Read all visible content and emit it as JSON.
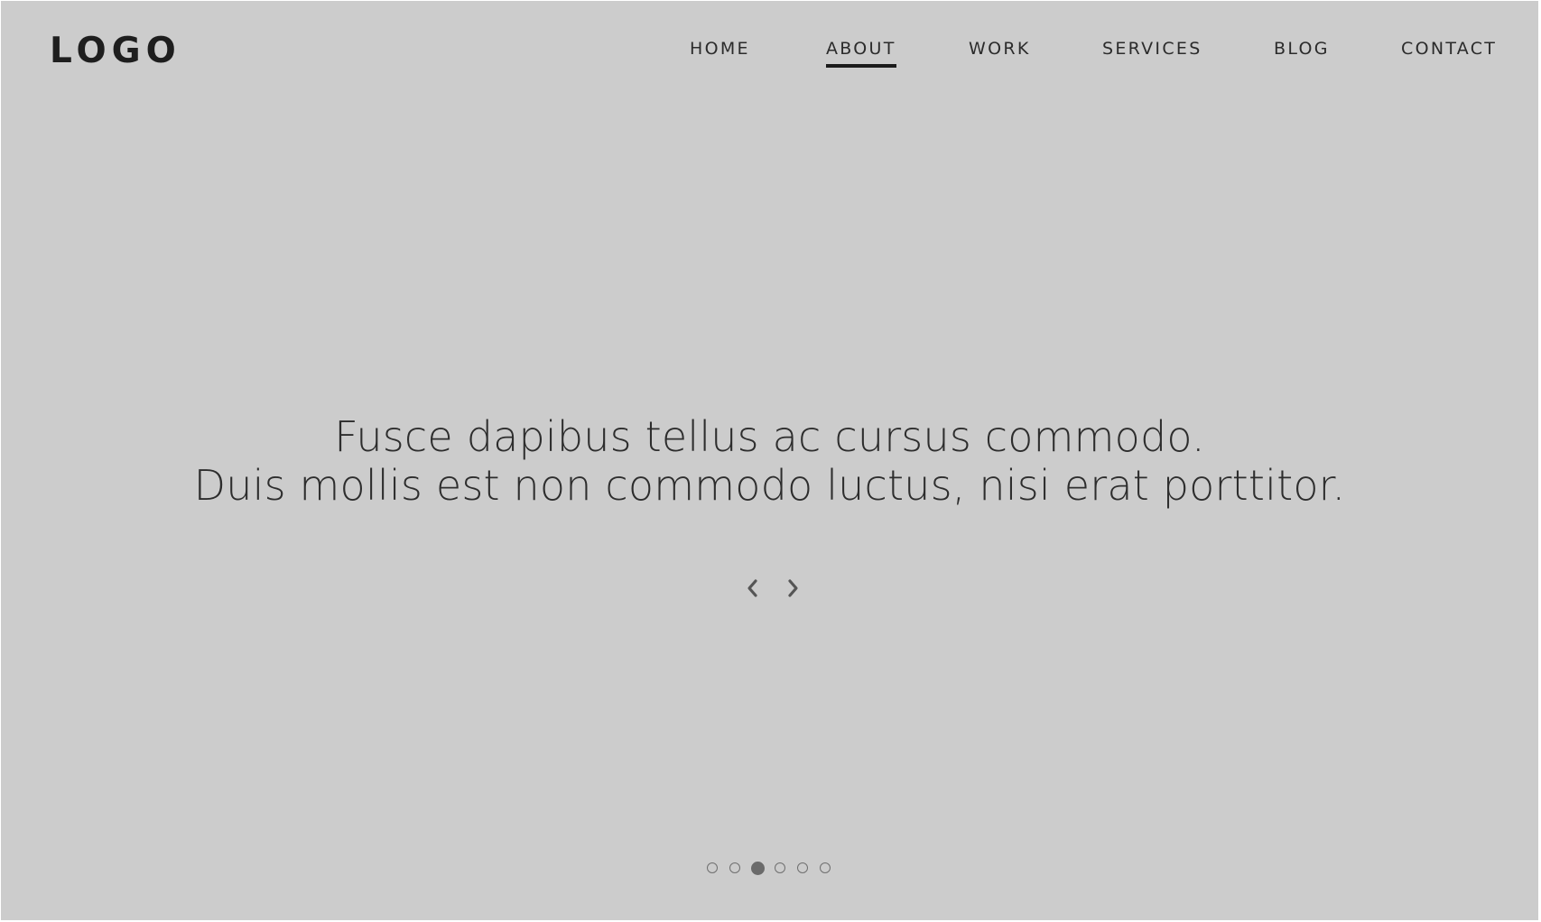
{
  "header": {
    "logo": "LOGO",
    "nav": [
      {
        "label": "HOME",
        "active": false
      },
      {
        "label": "ABOUT",
        "active": true
      },
      {
        "label": "WORK",
        "active": false
      },
      {
        "label": "SERVICES",
        "active": false
      },
      {
        "label": "BLOG",
        "active": false
      },
      {
        "label": "CONTACT",
        "active": false
      }
    ]
  },
  "hero": {
    "line1": "Fusce dapibus tellus ac cursus commodo.",
    "line2": "Duis mollis est non commodo luctus, nisi erat porttitor."
  },
  "slider": {
    "prev_icon": "chevron-left-icon",
    "next_icon": "chevron-right-icon",
    "total_slides": 6,
    "active_slide": 3
  },
  "colors": {
    "background": "#cccccc",
    "text": "#2d2d2d",
    "active_dot": "#6a6a6a"
  }
}
